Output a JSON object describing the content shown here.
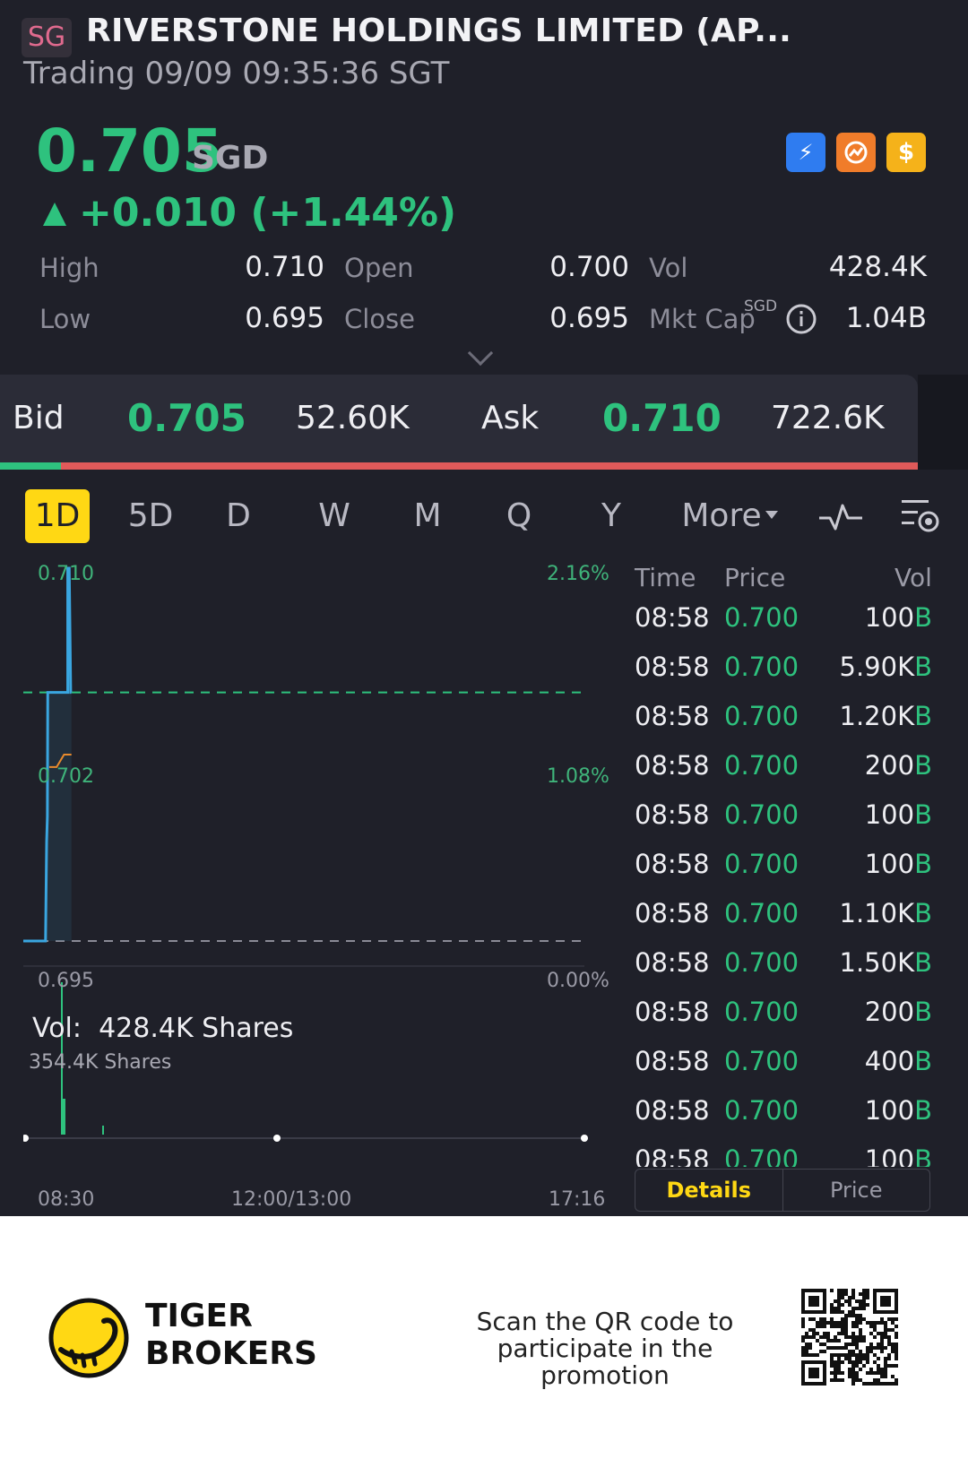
{
  "header": {
    "market": "SG",
    "title": "RIVERSTONE HOLDINGS LIMITED (AP...",
    "status": "Trading 09/09 09:35:36 SGT"
  },
  "quote": {
    "price": "0.705",
    "currency": "SGD",
    "change": "+0.010 (+1.44%)",
    "icons": [
      "lightning-icon",
      "options-icon",
      "dollar-icon"
    ],
    "icon_texts": {
      "lightning": "⚡",
      "dollar": "$"
    },
    "stats": {
      "high_label": "High",
      "high": "0.710",
      "open_label": "Open",
      "open": "0.700",
      "vol_label": "Vol",
      "vol": "428.4K",
      "low_label": "Low",
      "low": "0.695",
      "close_label": "Close",
      "close": "0.695",
      "mktcap_label": "Mkt Cap",
      "mktcap_unit": "SGD",
      "mktcap": "1.04B"
    }
  },
  "bidask": {
    "bid_label": "Bid",
    "bid_price": "0.705",
    "bid_size": "52.60K",
    "ask_label": "Ask",
    "ask_price": "0.710",
    "ask_size": "722.6K",
    "bid_ratio": 0.066
  },
  "tabs": [
    "1D",
    "5D",
    "D",
    "W",
    "M",
    "Q",
    "Y",
    "More"
  ],
  "chart": {
    "price_labels": {
      "top": "0.710",
      "mid": "0.702",
      "bottom": "0.695"
    },
    "pct_labels": {
      "top": "2.16%",
      "mid": "1.08%",
      "bottom": "0.00%"
    },
    "vol_label": "Vol:",
    "vol_value": "428.4K Shares",
    "vol_sub": "354.4K Shares",
    "time_labels": {
      "start": "08:30",
      "mid": "12:00/13:00",
      "end": "17:16"
    }
  },
  "chart_data": {
    "type": "line",
    "title": "",
    "xlabel": "",
    "ylabel": "",
    "ylim": [
      0.695,
      0.71
    ],
    "reference_close": 0.695,
    "series": [
      {
        "values_x_fraction": [
          0.0,
          0.06,
          0.063,
          0.065,
          0.066,
          0.07,
          0.12,
          0.12,
          0.124,
          0.128,
          0.13
        ],
        "values": [
          0.695,
          0.695,
          0.699,
          0.7,
          0.705,
          0.705,
          0.705,
          0.71,
          0.71,
          0.705,
          0.705
        ]
      },
      {
        "values_x_fraction": [
          0.07,
          0.09,
          0.11,
          0.13
        ],
        "values": [
          0.702,
          0.702,
          0.7025,
          0.7025
        ]
      }
    ]
  },
  "ticks": {
    "headers": {
      "time": "Time",
      "price": "Price",
      "vol": "Vol"
    },
    "rows": [
      {
        "time": "08:58",
        "price": "0.700",
        "vol": "100",
        "side": "B"
      },
      {
        "time": "08:58",
        "price": "0.700",
        "vol": "5.90K",
        "side": "B"
      },
      {
        "time": "08:58",
        "price": "0.700",
        "vol": "1.20K",
        "side": "B"
      },
      {
        "time": "08:58",
        "price": "0.700",
        "vol": "200",
        "side": "B"
      },
      {
        "time": "08:58",
        "price": "0.700",
        "vol": "100",
        "side": "B"
      },
      {
        "time": "08:58",
        "price": "0.700",
        "vol": "100",
        "side": "B"
      },
      {
        "time": "08:58",
        "price": "0.700",
        "vol": "1.10K",
        "side": "B"
      },
      {
        "time": "08:58",
        "price": "0.700",
        "vol": "1.50K",
        "side": "B"
      },
      {
        "time": "08:58",
        "price": "0.700",
        "vol": "200",
        "side": "B"
      },
      {
        "time": "08:58",
        "price": "0.700",
        "vol": "400",
        "side": "B"
      },
      {
        "time": "08:58",
        "price": "0.700",
        "vol": "100",
        "side": "B"
      },
      {
        "time": "08:58",
        "price": "0.700",
        "vol": "100",
        "side": "B"
      }
    ],
    "segment": {
      "details": "Details",
      "price": "Price"
    }
  },
  "footer": {
    "brand_line1": "TIGER",
    "brand_line2": "BROKERS",
    "promo": "Scan the QR code to participate in the promotion"
  },
  "colors": {
    "up": "#2ec27e",
    "down": "#e05a5a",
    "accent": "#ffd814",
    "line": "#3aa6e0",
    "avg": "#e88a2c"
  }
}
